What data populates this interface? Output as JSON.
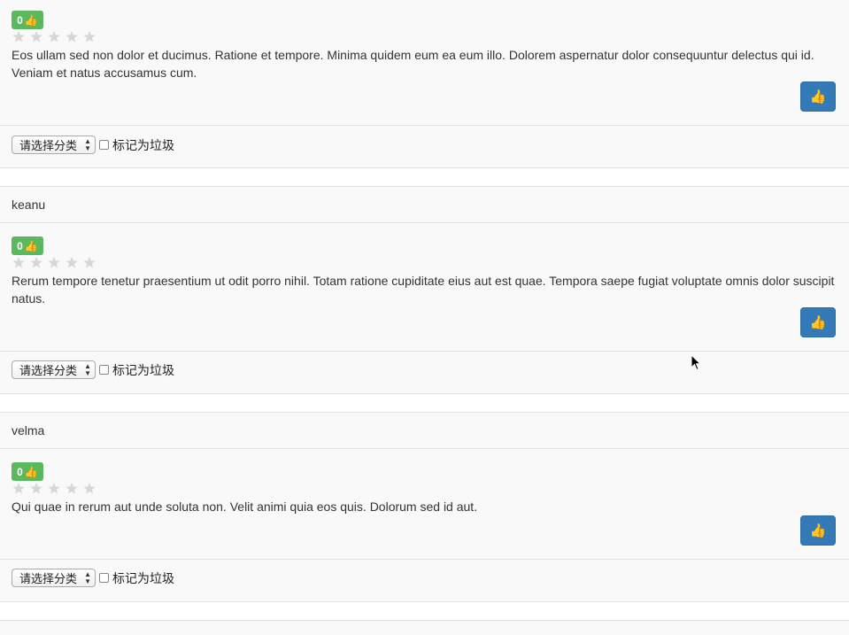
{
  "comments": [
    {
      "author": "",
      "likes": "0",
      "text": "Eos ullam sed non dolor et ducimus. Ratione et tempore. Minima quidem eum ea eum illo. Dolorem aspernatur dolor consequuntur delectus qui id. Veniam et natus accusamus cum.",
      "rating": 0,
      "category_placeholder": "请选择分类",
      "spam_label": "标记为垃圾"
    },
    {
      "author": "keanu",
      "likes": "0",
      "text": "Rerum tempore tenetur praesentium ut odit porro nihil. Totam ratione cupiditate eius aut est quae. Tempora saepe fugiat voluptate omnis dolor suscipit natus.",
      "rating": 0,
      "category_placeholder": "请选择分类",
      "spam_label": "标记为垃圾"
    },
    {
      "author": "velma",
      "likes": "0",
      "text": "Qui quae in rerum aut unde soluta non. Velit animi quia eos quis. Dolorum sed id aut.",
      "rating": 0,
      "category_placeholder": "请选择分类",
      "spam_label": "标记为垃圾"
    }
  ],
  "icons": {
    "thumb": "thumbs-up-icon",
    "star": "star-icon"
  },
  "colors": {
    "badge": "#5cb85c",
    "like_button": "#337ab7",
    "star_empty": "#d6d6d6"
  }
}
